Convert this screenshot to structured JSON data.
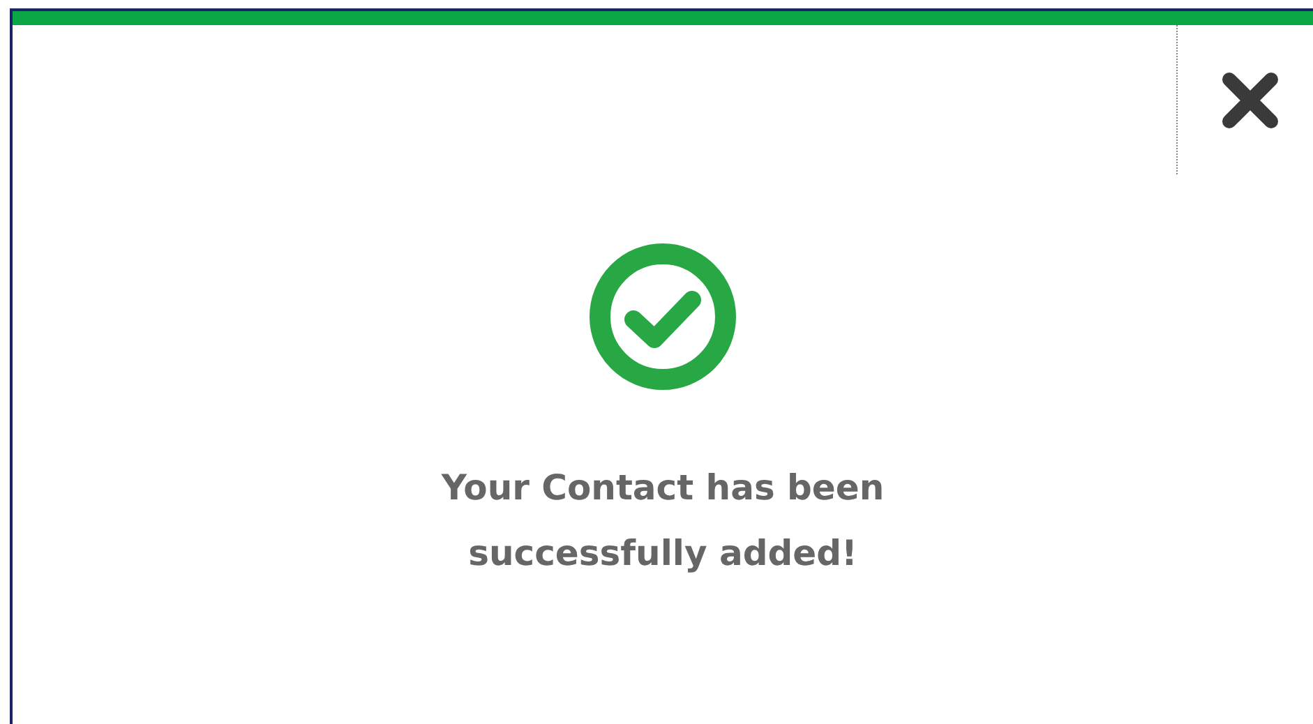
{
  "dialog": {
    "message": "Your Contact has been successfully added!"
  }
}
